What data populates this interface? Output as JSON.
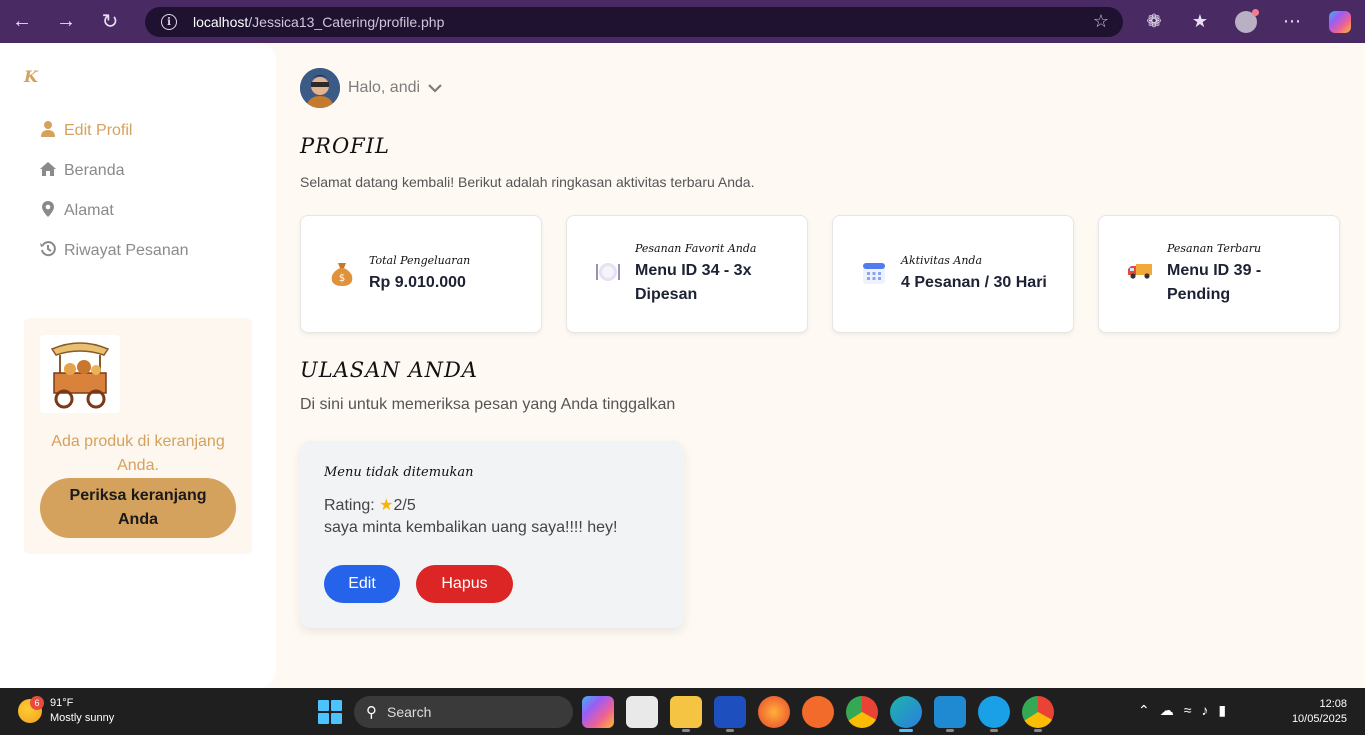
{
  "browser": {
    "url_host": "localhost",
    "url_path": "/Jessica13_Catering/profile.php"
  },
  "sidebar": {
    "logo": "K",
    "items": [
      {
        "label": "Edit Profil",
        "icon": "user-icon",
        "active": true
      },
      {
        "label": "Beranda",
        "icon": "home-icon",
        "active": false
      },
      {
        "label": "Alamat",
        "icon": "map-pin-icon",
        "active": false
      },
      {
        "label": "Riwayat Pesanan",
        "icon": "history-icon",
        "active": false
      }
    ],
    "cart_notice": "Ada produk di keranjang Anda.",
    "cart_button": "Periksa keranjang Anda"
  },
  "header": {
    "greeting": "Halo, andi"
  },
  "profile": {
    "title": "PROFIL",
    "subtitle": "Selamat datang kembali! Berikut adalah ringkasan aktivitas terbaru Anda.",
    "cards": [
      {
        "label": "Total Pengeluaran",
        "value": "Rp 9.010.000",
        "icon": "money-bag-icon"
      },
      {
        "label": "Pesanan Favorit Anda",
        "value": "Menu ID 34 - 3x Dipesan",
        "icon": "plate-icon"
      },
      {
        "label": "Aktivitas Anda",
        "value": "4 Pesanan / 30 Hari",
        "icon": "calendar-icon"
      },
      {
        "label": "Pesanan Terbaru",
        "value": "Menu ID 39 - Pending",
        "icon": "truck-icon"
      }
    ]
  },
  "reviews": {
    "title": "ULASAN ANDA",
    "subtitle": "Di sini untuk memeriksa pesan yang Anda tinggalkan",
    "items": [
      {
        "menu": "Menu tidak ditemukan",
        "rating_label": "Rating:",
        "rating": "2/5",
        "comment": "saya minta kembalikan uang saya!!!! hey!",
        "edit_label": "Edit",
        "delete_label": "Hapus"
      }
    ]
  },
  "taskbar": {
    "weather_temp": "91°F",
    "weather_desc": "Mostly sunny",
    "weather_badge": "6",
    "search_placeholder": "Search",
    "time": "12:08",
    "date": "10/05/2025"
  },
  "colors": {
    "accent": "#d4a25c",
    "edit": "#2563eb",
    "delete": "#dc2626",
    "browser_bar": "#4a2a63"
  }
}
